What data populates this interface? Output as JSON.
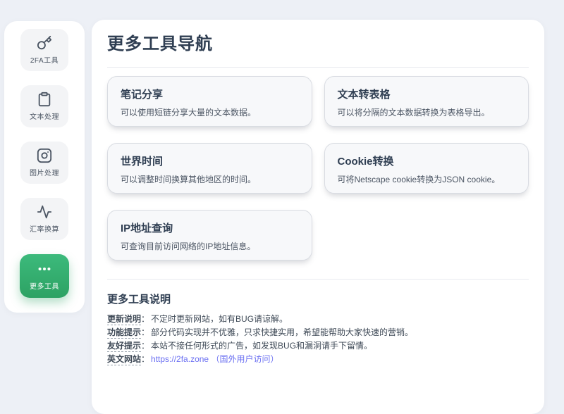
{
  "colors": {
    "accent": "#35ad6f",
    "accent2": "#2da263",
    "link": "#6b70f2",
    "heading": "#2f3e52",
    "page_bg": "#edf0f6",
    "card_bg": "#f7f8fa",
    "card_border": "#d9dce2",
    "text": "#4b5563"
  },
  "sidebar": {
    "items": [
      {
        "label": "2FA工具",
        "icon": "key-icon",
        "active": false
      },
      {
        "label": "文本处理",
        "icon": "clipboard-icon",
        "active": false
      },
      {
        "label": "图片处理",
        "icon": "image-icon",
        "active": false
      },
      {
        "label": "汇率换算",
        "icon": "activity-icon",
        "active": false
      },
      {
        "label": "更多工具",
        "icon": "ellipsis-icon",
        "active": true
      }
    ]
  },
  "main": {
    "title": "更多工具导航",
    "cards": [
      {
        "title": "笔记分享",
        "desc": "可以使用短链分享大量的文本数据。"
      },
      {
        "title": "文本转表格",
        "desc": "可以将分隔的文本数据转换为表格导出。"
      },
      {
        "title": "世界时间",
        "desc": "可以调整时间换算其他地区的时间。"
      },
      {
        "title": "Cookie转换",
        "desc": "可将Netscape cookie转换为JSON cookie。"
      },
      {
        "title": "IP地址查询",
        "desc": "可查询目前访问网络的IP地址信息。"
      }
    ],
    "notes": {
      "heading": "更多工具说明",
      "separator": "：",
      "lines": [
        {
          "label": "更新说明",
          "text": "不定时更新网站，如有BUG请谅解。"
        },
        {
          "label": "功能提示",
          "text": "部分代码实现并不优雅，只求快捷实用，希望能帮助大家快速的营销。"
        },
        {
          "label": "友好提示",
          "text": "本站不接任何形式的广告，如发现BUG和漏洞请手下留情。"
        },
        {
          "label": "英文网站",
          "link_text": "https://2fa.zone",
          "link_note": "（国外用户访问）"
        }
      ]
    }
  }
}
